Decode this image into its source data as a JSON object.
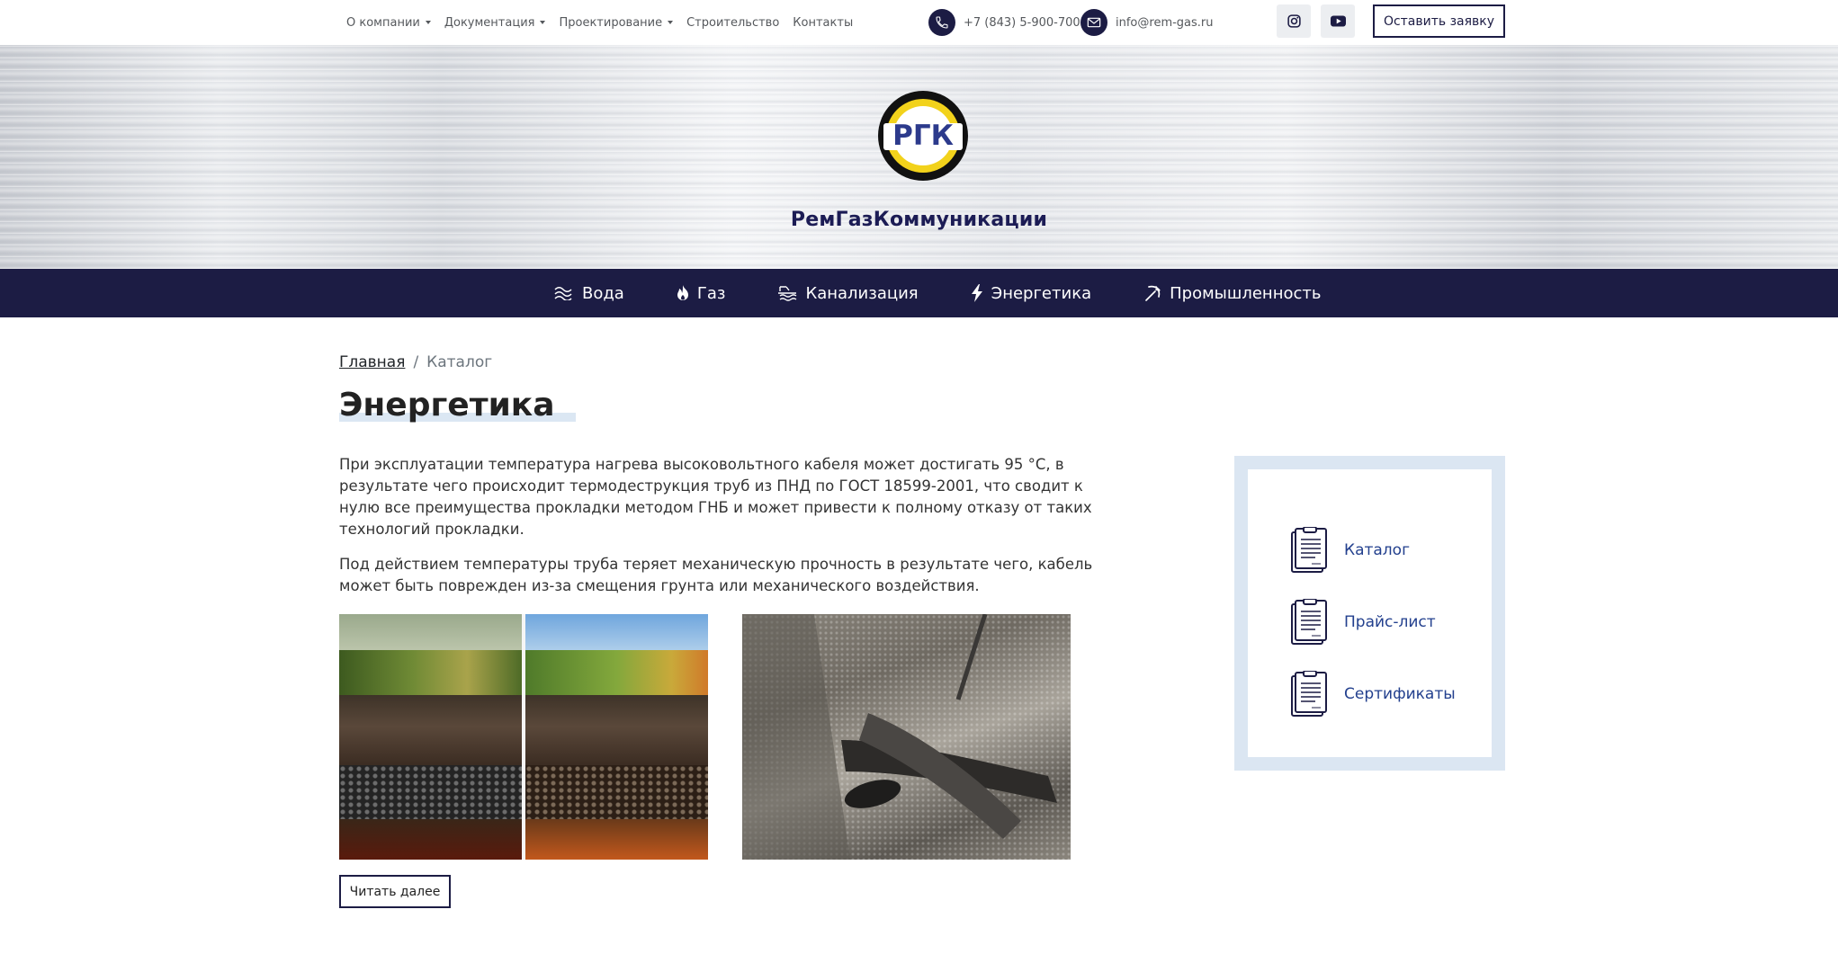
{
  "topbar": {
    "nav": [
      {
        "label": "О компании",
        "dropdown": true
      },
      {
        "label": "Документация",
        "dropdown": true
      },
      {
        "label": "Проектирование",
        "dropdown": true
      },
      {
        "label": "Строительство",
        "dropdown": false
      },
      {
        "label": "Контакты",
        "dropdown": false
      }
    ],
    "phone": "+7 (843) 5-900-700",
    "email": "info@rem-gas.ru",
    "social": [
      "instagram-icon",
      "youtube-icon"
    ],
    "order_button": "Оставить заявку"
  },
  "hero": {
    "logo_text": "РГК",
    "brand_name": "РемГазКоммуникации",
    "colors": {
      "logo_blue": "#2c3a8c",
      "logo_yellow": "#f2d21b",
      "logo_black": "#111111"
    }
  },
  "categories": [
    {
      "label": "Вода",
      "icon": "water-waves-icon"
    },
    {
      "label": "Газ",
      "icon": "flame-icon"
    },
    {
      "label": "Канализация",
      "icon": "sewer-icon"
    },
    {
      "label": "Энергетика",
      "icon": "lightning-icon"
    },
    {
      "label": "Промышленность",
      "icon": "pickaxe-icon"
    }
  ],
  "breadcrumb": {
    "home": "Главная",
    "separator": "/",
    "current": "Каталог"
  },
  "page": {
    "title": "Энергетика",
    "paragraphs": [
      "При эксплуатации температура нагрева высоковольтного кабеля может достигать 95 °C, в результате чего происходит термодеструкция труб из ПНД по ГОСТ 18599-2001, что сводит к нулю все преимущества прокладки методом ГНБ и может привести к полному отказу от таких технологий прокладки.",
      "Под действием температуры труба теряет механическую прочность  в результате чего, кабель может быть поврежден из-за смещения грунта или механического воздействия."
    ],
    "read_more": "Читать далее"
  },
  "sidebar": {
    "links": [
      {
        "label": "Каталог",
        "icon": "document-icon"
      },
      {
        "label": "Прайс-лист",
        "icon": "document-icon"
      },
      {
        "label": "Сертификаты",
        "icon": "document-icon"
      }
    ]
  },
  "colors": {
    "navy": "#1c1c44",
    "link_blue": "#23408e",
    "sidebar_bg": "#dbe6f2"
  }
}
